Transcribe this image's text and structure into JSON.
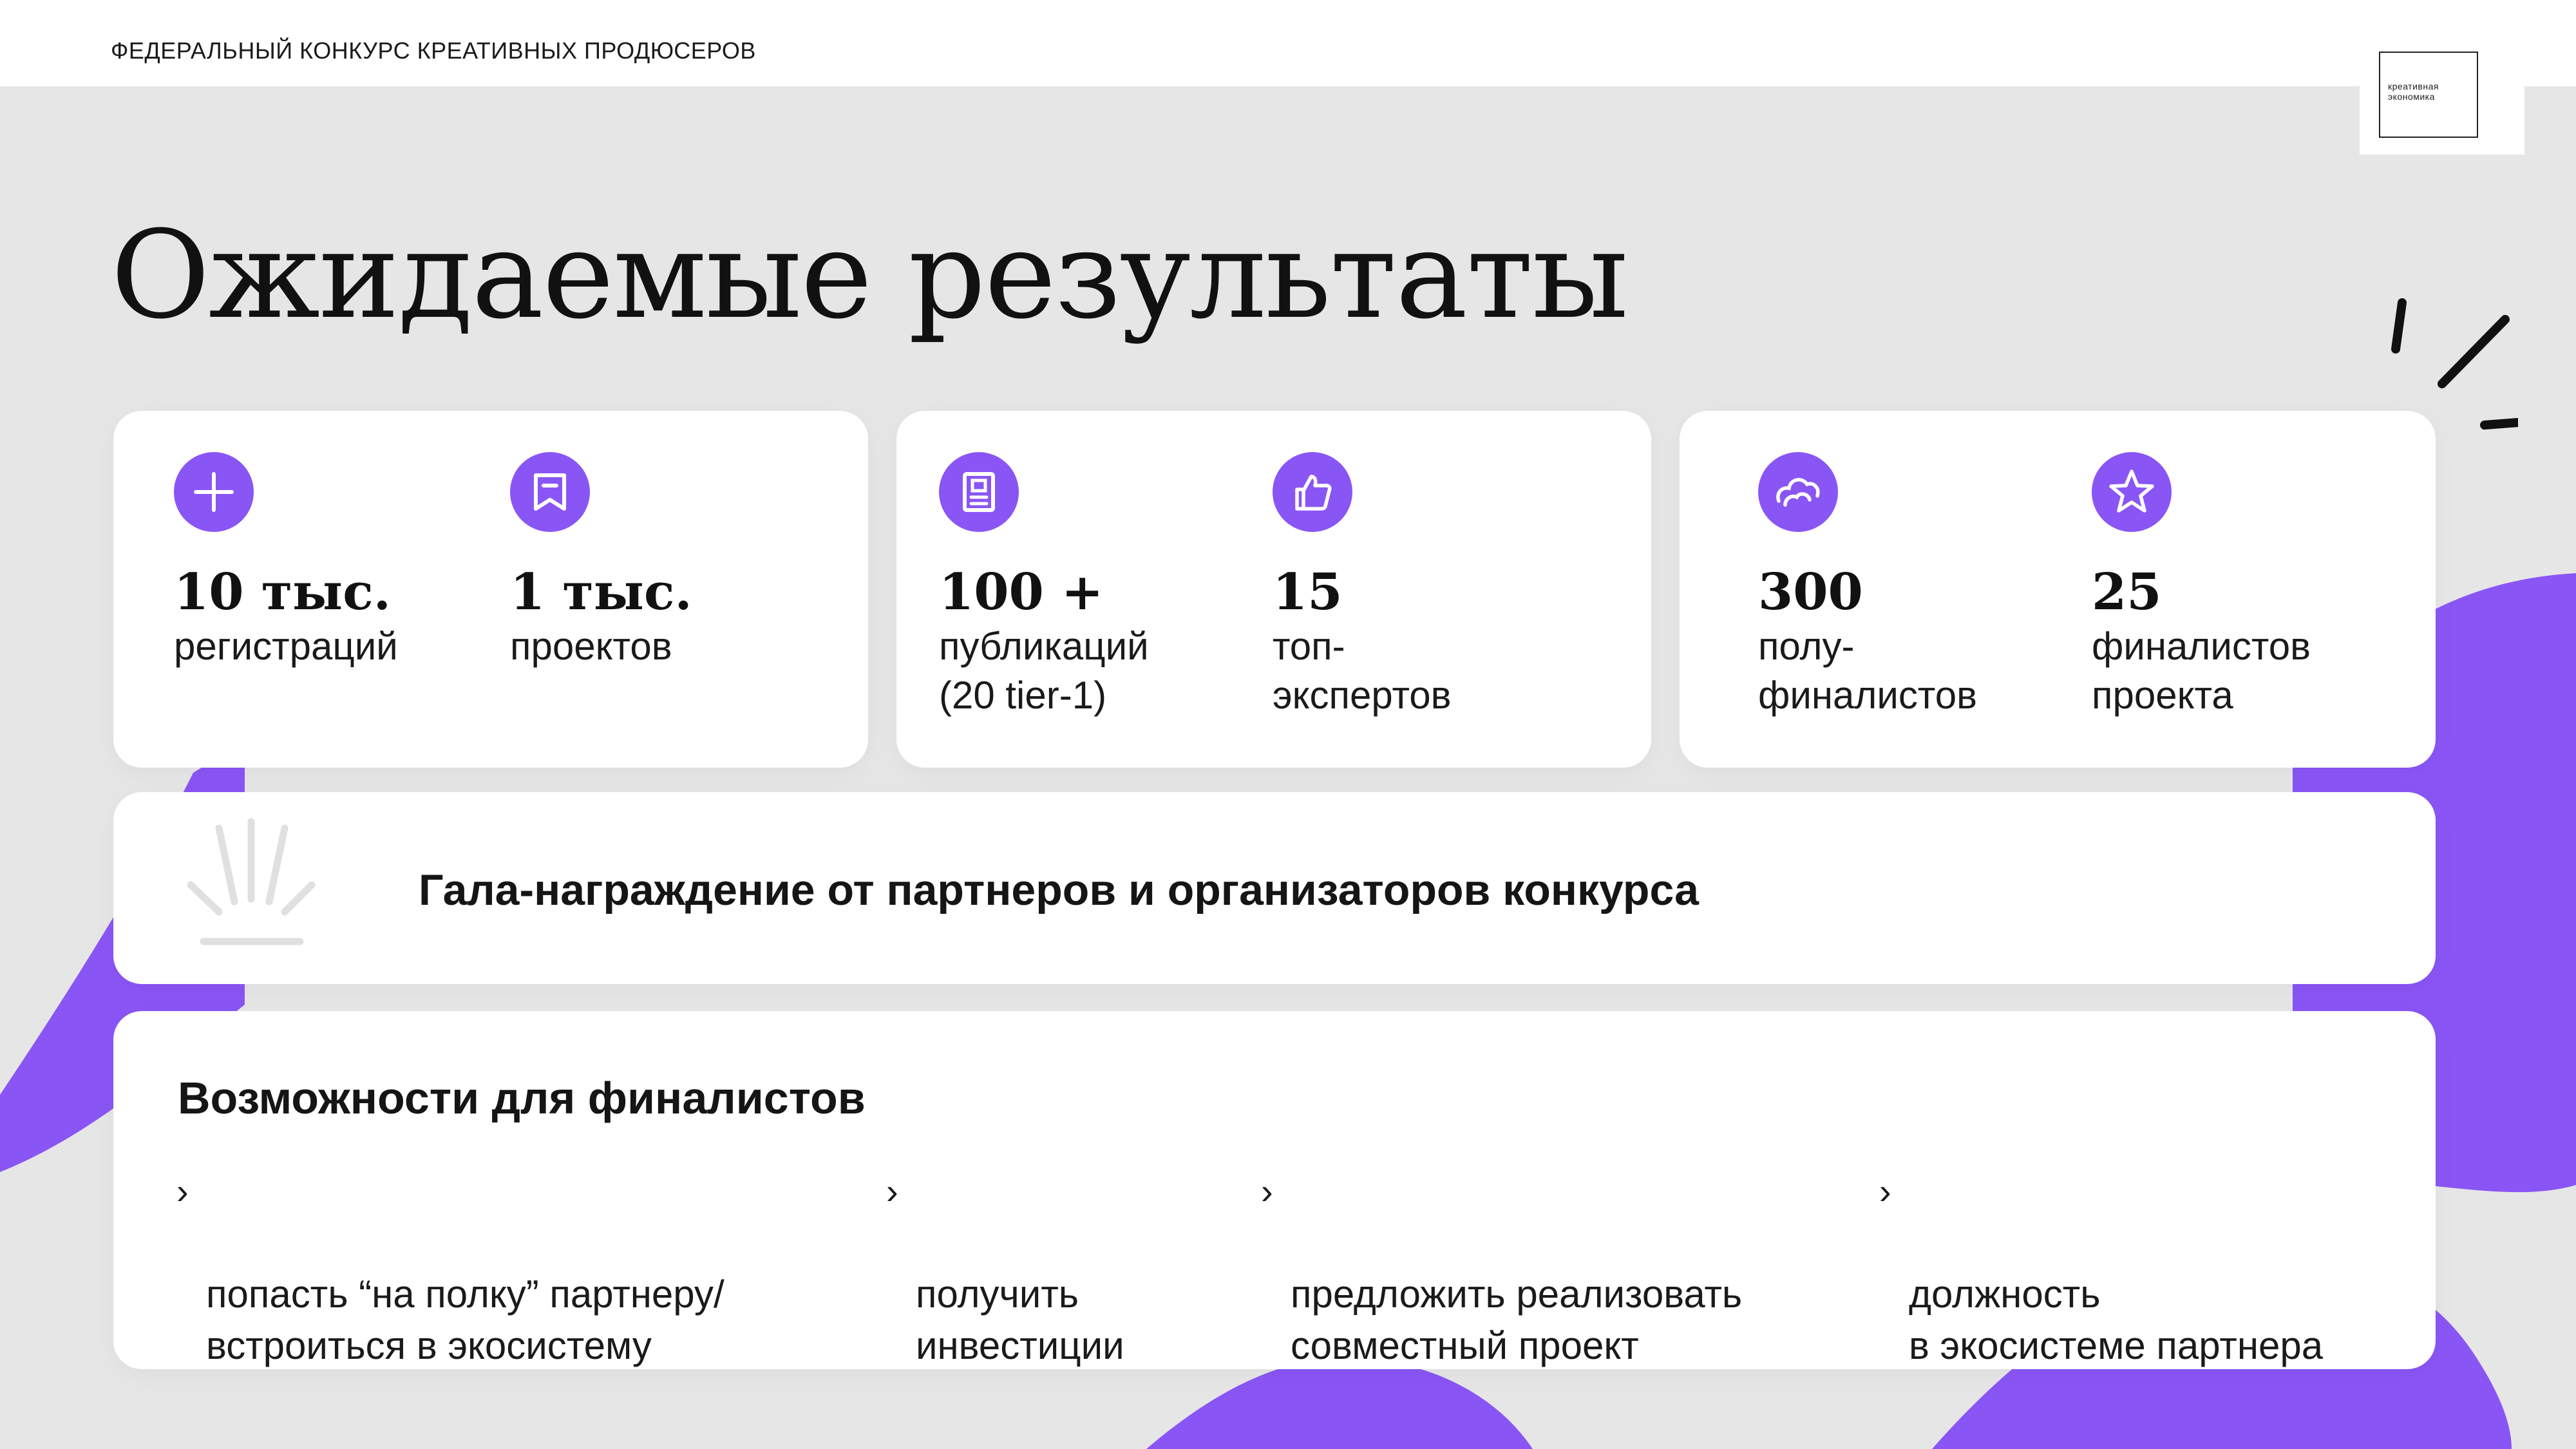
{
  "header": {
    "title": "Федеральный конкурс креативных продюсеров",
    "logo_text": "креативная\nэкономика"
  },
  "page": {
    "title": "Ожидаемые результаты"
  },
  "stats": [
    {
      "icon": "plus-icon",
      "number": "10 тыс.",
      "label": "регистраций"
    },
    {
      "icon": "bookmark-icon",
      "number": "1 тыс.",
      "label": "проектов"
    },
    {
      "icon": "document-icon",
      "number": "100 +",
      "label": "публикаций\n(20 tier-1)"
    },
    {
      "icon": "thumbs-up-icon",
      "number": "15",
      "label": "топ-\nэкспертов"
    },
    {
      "icon": "cloud-icon",
      "number": "300",
      "label": "полу-\nфиналистов"
    },
    {
      "icon": "star-icon",
      "number": "25",
      "label": "финалистов\nпроекта"
    }
  ],
  "gala": {
    "text": "Гала-награждение от партнеров и организаторов конкурса",
    "icon": "award-rays-icon"
  },
  "opportunities": {
    "title": "Возможности для финалистов",
    "bullet_icon": "chevron-right-icon",
    "items": [
      "попасть “на полку” партнеру/\nвстроиться в экосистему",
      "получить\nинвестиции",
      "предложить реализовать\nсовместный проект",
      "должность\nв экосистеме партнера"
    ]
  },
  "colors": {
    "accent": "#8a55f5",
    "background": "#e6e6e6",
    "card": "#ffffff"
  }
}
